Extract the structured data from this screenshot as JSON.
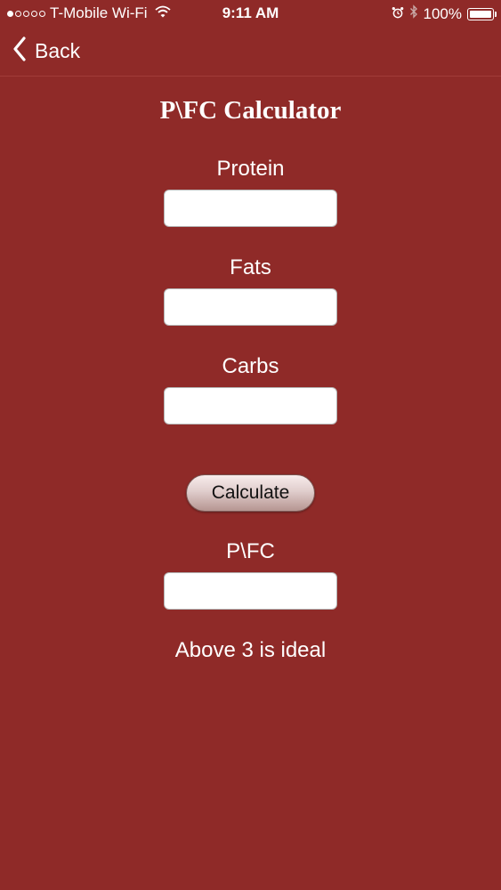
{
  "status_bar": {
    "carrier": "T-Mobile Wi-Fi",
    "time": "9:11 AM",
    "battery": "100%",
    "signal_bars_filled": 1,
    "signal_bars_total": 5
  },
  "nav": {
    "back_label": "Back"
  },
  "title": "P\\FC Calculator",
  "form": {
    "protein_label": "Protein",
    "protein_value": "",
    "fats_label": "Fats",
    "fats_value": "",
    "carbs_label": "Carbs",
    "carbs_value": "",
    "calculate_label": "Calculate",
    "result_label": "P\\FC",
    "result_value": "",
    "hint": "Above 3 is ideal"
  },
  "colors": {
    "background": "#8f2a28",
    "text": "#ffffff",
    "button_text": "#111111"
  },
  "icons": {
    "signal": "signal-dots-icon",
    "wifi": "wifi-icon",
    "alarm": "alarm-clock-icon",
    "bluetooth": "bluetooth-icon",
    "battery": "battery-icon",
    "back": "chevron-left-icon"
  }
}
